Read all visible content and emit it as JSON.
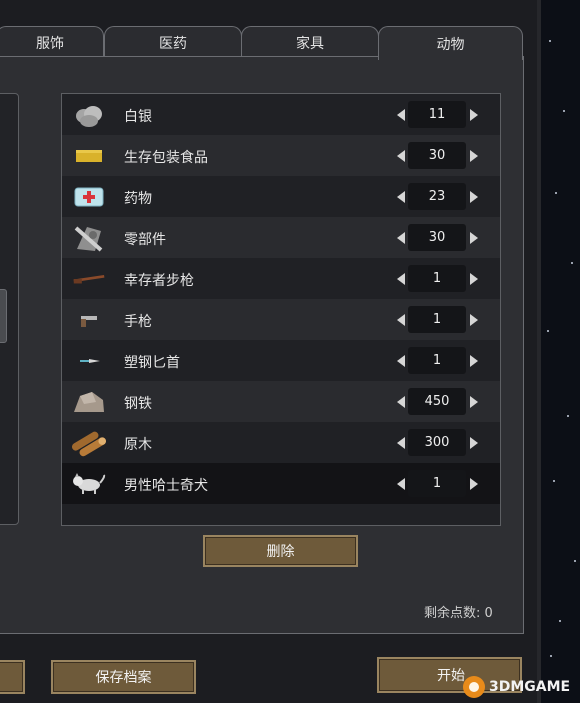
{
  "tabs": [
    {
      "label": "服饰",
      "active": false
    },
    {
      "label": "医药",
      "active": false
    },
    {
      "label": "家具",
      "active": false
    },
    {
      "label": "动物",
      "active": true
    }
  ],
  "items": [
    {
      "name": "白银",
      "qty": "11",
      "icon": "silver-icon"
    },
    {
      "name": "生存包装食品",
      "qty": "30",
      "icon": "packaged-food-icon"
    },
    {
      "name": "药物",
      "qty": "23",
      "icon": "medicine-icon"
    },
    {
      "name": "零部件",
      "qty": "30",
      "icon": "components-icon"
    },
    {
      "name": "幸存者步枪",
      "qty": "1",
      "icon": "rifle-icon"
    },
    {
      "name": "手枪",
      "qty": "1",
      "icon": "pistol-icon"
    },
    {
      "name": "塑钢匕首",
      "qty": "1",
      "icon": "knife-icon"
    },
    {
      "name": "钢铁",
      "qty": "450",
      "icon": "steel-icon"
    },
    {
      "name": "原木",
      "qty": "300",
      "icon": "wood-icon"
    },
    {
      "name": "男性哈士奇犬",
      "qty": "1",
      "icon": "husky-icon"
    }
  ],
  "buttons": {
    "delete": "删除",
    "save_profile": "保存档案",
    "start": "开始"
  },
  "remaining_points": "剩余点数: 0",
  "watermark": {
    "text": "3DMGAME"
  },
  "colors": {
    "button_fill": "#6e5a3a",
    "panel_bg": "#2e2f33",
    "selected_row": "#131316"
  }
}
